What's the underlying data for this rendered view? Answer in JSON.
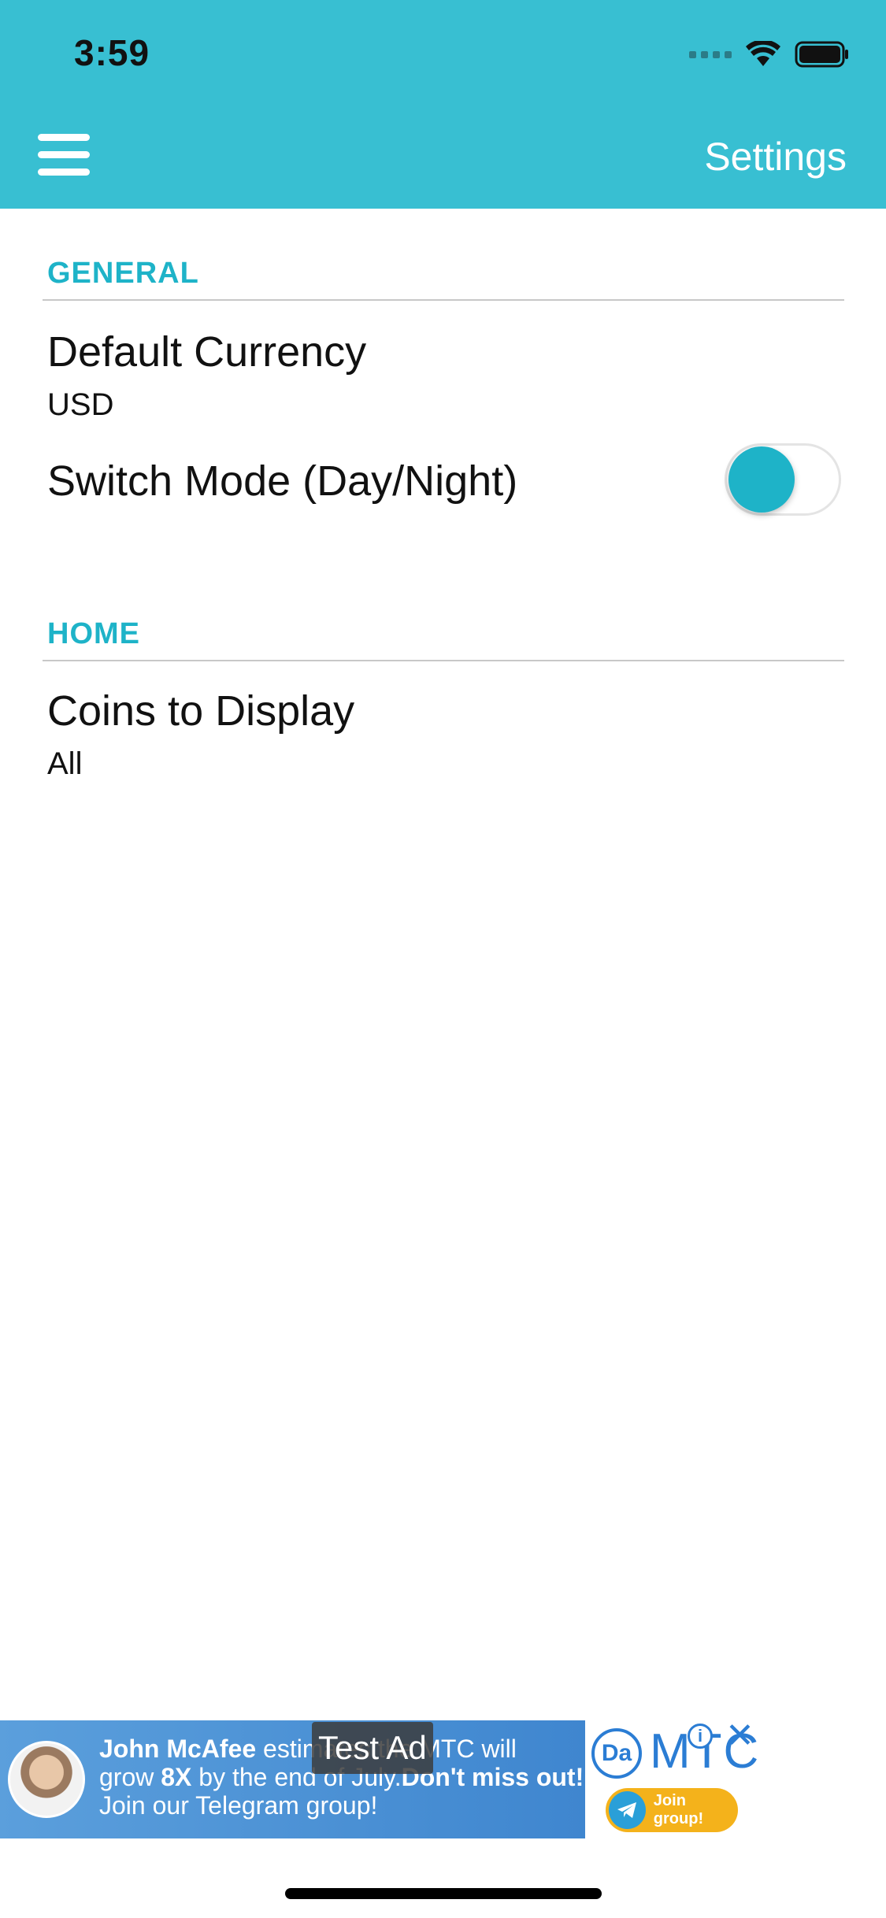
{
  "status_bar": {
    "time": "3:59"
  },
  "header": {
    "title": "Settings"
  },
  "sections": {
    "general": {
      "heading": "GENERAL",
      "default_currency": {
        "label": "Default Currency",
        "value": "USD"
      },
      "switch_mode": {
        "label": "Switch Mode (Day/Night)",
        "enabled": false
      }
    },
    "home": {
      "heading": "HOME",
      "coins_to_display": {
        "label": "Coins to Display",
        "value": "All"
      }
    }
  },
  "ad": {
    "badge": "Test Ad",
    "line1_name": "John McAfee",
    "line1_rest": " estimates the MTC will",
    "line2_pre": "grow ",
    "line2_bold": "8X",
    "line2_mid": " by the end of July.",
    "line2_end": "Don't miss out!",
    "line3": "Join our Telegram group!",
    "logo_text": "Da",
    "brand": "MTC",
    "join_label": "Join group!"
  },
  "colors": {
    "accent": "#38bfd2",
    "section_heading": "#1eb3c8"
  }
}
